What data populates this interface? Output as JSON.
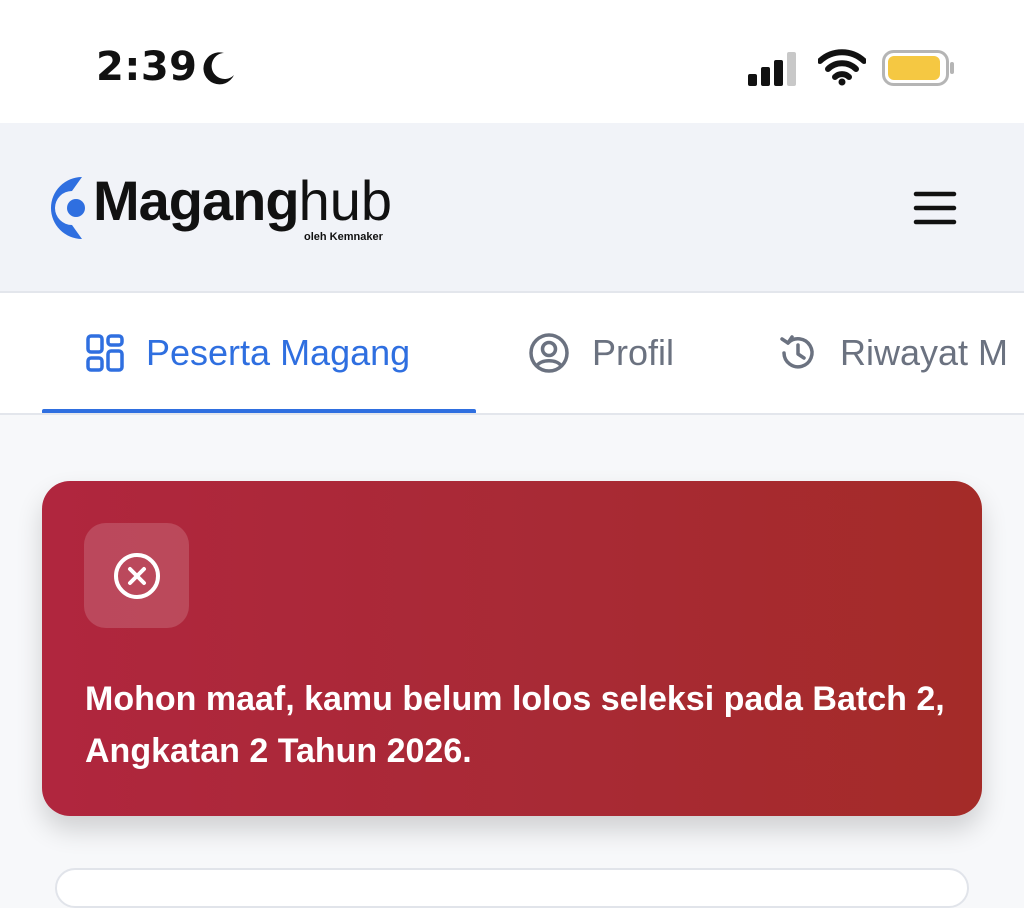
{
  "status_bar": {
    "time": "2:39",
    "icons": [
      "moon-icon",
      "cellular-signal-icon",
      "wifi-icon",
      "battery-icon"
    ],
    "battery_color": "#f5c842"
  },
  "header": {
    "logo_main": "Maganghub",
    "logo_bold": "Magang",
    "logo_light": "hub",
    "logo_sub": "oleh Kemnaker",
    "brand_color": "#2f6fe0",
    "menu_icon": "hamburger-menu-icon"
  },
  "tabs": [
    {
      "label": "Peserta Magang",
      "icon": "dashboard-grid-icon",
      "active": true
    },
    {
      "label": "Profil",
      "icon": "user-circle-icon",
      "active": false
    },
    {
      "label": "Riwayat M",
      "icon": "history-icon",
      "active": false
    }
  ],
  "alert": {
    "icon": "close-circle-icon",
    "message": "Mohon maaf, kamu belum lolos seleksi pada Batch 2, Angkatan 2 Tahun 2026.",
    "colors": {
      "start": "#b0263e",
      "end": "#a42b28"
    }
  }
}
